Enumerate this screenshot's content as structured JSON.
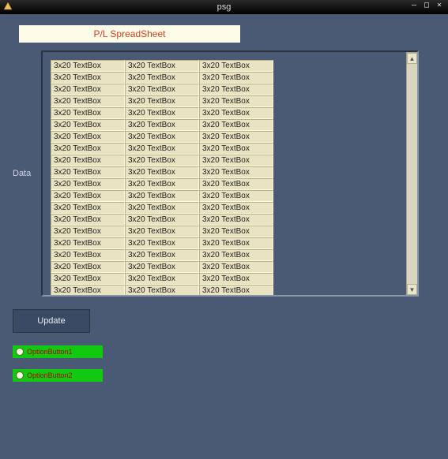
{
  "window": {
    "title": "psg",
    "min_label": "–",
    "max_label": "□",
    "close_label": "×"
  },
  "heading": "P/L SpreadSheet",
  "data_label": "Data",
  "cell_text": "3x20 TextBox",
  "grid": {
    "rows": 20,
    "cols": 3
  },
  "update_label": "Update",
  "options": [
    {
      "label": "OptionButton1"
    },
    {
      "label": "OptionButton2"
    }
  ]
}
